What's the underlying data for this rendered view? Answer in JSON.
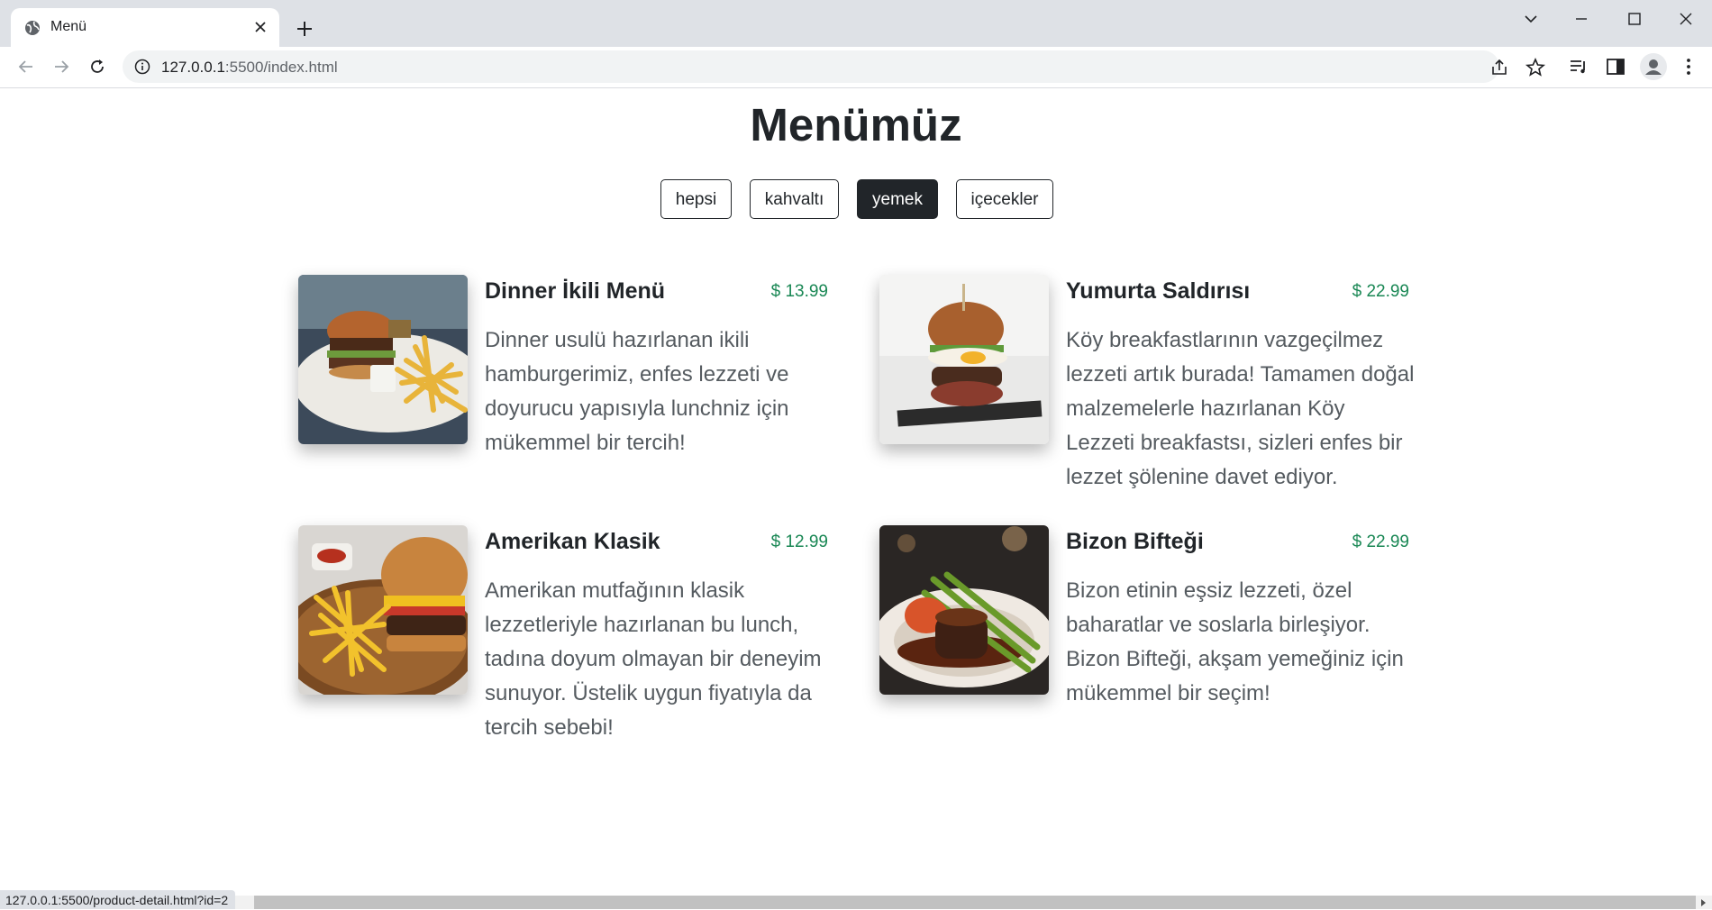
{
  "browser": {
    "tab_title": "Menü",
    "url_host": "127.0.0.1",
    "url_path": ":5500/index.html",
    "status_url": "127.0.0.1:5500/product-detail.html?id=2"
  },
  "page": {
    "title": "Menümüz"
  },
  "filters": [
    {
      "label": "hepsi",
      "active": false
    },
    {
      "label": "kahvaltı",
      "active": false
    },
    {
      "label": "yemek",
      "active": true
    },
    {
      "label": "içecekler",
      "active": false
    }
  ],
  "items": [
    {
      "name": "Dinner İkili Menü",
      "price": "$ 13.99",
      "description": "Dinner usulü hazırlanan ikili hamburgerimiz, enfes lezzeti ve doyurucu yapısıyla lunchniz için mükemmel bir tercih!",
      "image": "burger-fries-plate-photo"
    },
    {
      "name": "Yumurta Saldırısı",
      "price": "$ 22.99",
      "description": "Köy breakfastlarının vazgeçilmez lezzeti artık burada! Tamamen doğal malzemelerle hazırlanan Köy Lezzeti breakfastsı, sizleri enfes bir lezzet şölenine davet ediyor.",
      "image": "egg-burger-photo"
    },
    {
      "name": "Amerikan Klasik",
      "price": "$ 12.99",
      "description": "Amerikan mutfağının klasik lezzetleriyle hazırlanan bu lunch, tadına doyum olmayan bir deneyim sunuyor. Üstelik uygun fiyatıyla da tercih sebebi!",
      "image": "cheeseburger-fries-board-photo"
    },
    {
      "name": "Bizon Bifteği",
      "price": "$ 22.99",
      "description": "Bizon etinin eşsiz lezzeti, özel baharatlar ve soslarla birleşiyor. Bizon Bifteği, akşam yemeğiniz için mükemmel bir seçim!",
      "image": "steak-asparagus-plate-photo"
    }
  ],
  "colors": {
    "accent_dark": "#212529",
    "price_green": "#198754",
    "text_muted": "#555b60",
    "tabstrip_bg": "#dee1e6"
  }
}
